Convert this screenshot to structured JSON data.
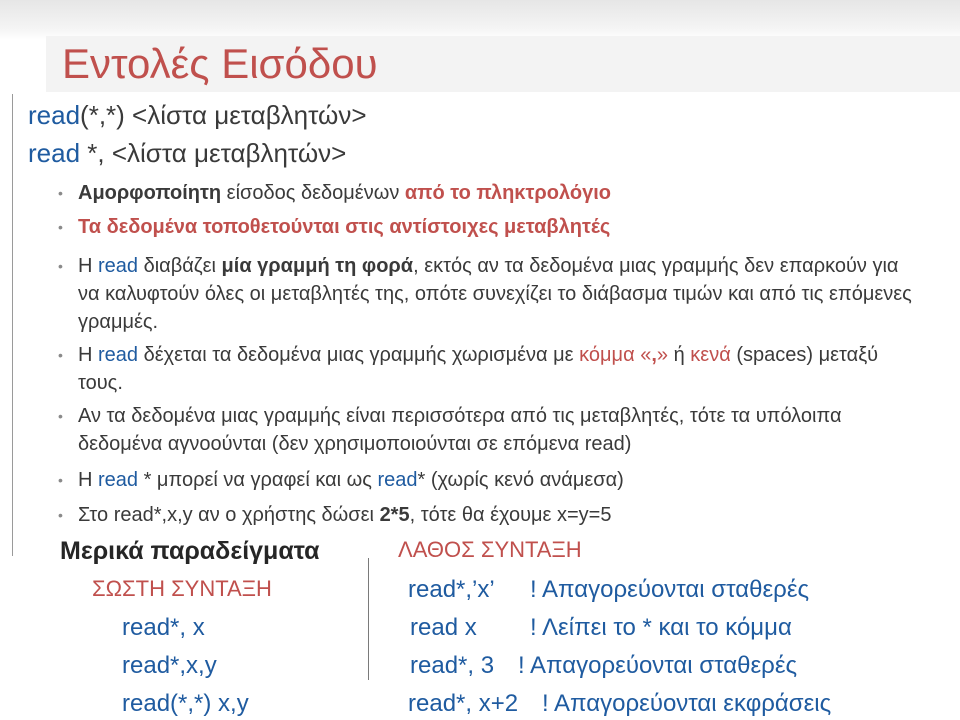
{
  "title": "Εντολές Εισόδου",
  "syntax": [
    {
      "kw": "read",
      "rest": "(*,*)  <λίστα μεταβλητών>"
    },
    {
      "kw": "read",
      "rest": " *, <λίστα μεταβλητών>"
    }
  ],
  "bullets": {
    "b1": {
      "bold": "Αμορφοποίητη",
      "mid": " είσοδος δεδομένων ",
      "red": "από το πληκτρολόγιο"
    },
    "b2": {
      "red": "Τα δεδομένα τοποθετούνται στις αντίστοιχες μεταβλητές"
    },
    "b3": {
      "a": "Η ",
      "read": "read",
      "b": " διαβάζει ",
      "bold": "μία γραμμή τη φορά",
      "c": ", εκτός αν τα δεδομένα μιας γραμμής δεν επαρκούν για να καλυφτούν όλες οι μεταβλητές της, οπότε συνεχίζει το διάβασμα τιμών και από τις επόμενες γραμμές."
    },
    "b4": {
      "a": "Η ",
      "read": "read",
      "b": " δέχεται τα δεδομένα μιας γραμμής χωρισμένα με ",
      "comma": "κόμμα",
      "c": " ",
      "q1": "«",
      "sym": ",",
      "q2": "»",
      "d": " ή ",
      "spaces": "κενά",
      "e": " (spaces) μεταξύ τους."
    },
    "b5": {
      "text": "Αν τα δεδομένα μιας γραμμής είναι περισσότερα από τις μεταβλητές, τότε τα υπόλοιπα δεδομένα αγνοούνται (δεν χρησιμοποιούνται σε επόμενα read)"
    },
    "b6": {
      "a": "Η ",
      "read1": "read",
      "b": " * μπορεί να γραφεί και ως ",
      "read2": "read",
      "c": "* (χωρίς κενό ανάμεσα)"
    },
    "b7": {
      "a": "Στο read*,x,y αν ο χρήστης δώσει ",
      "bold": "2*5",
      "c": ", τότε θα έχουμε x=y=5"
    }
  },
  "examples": {
    "heading": "Μερικά παραδείγματα",
    "correct_label": "ΣΩΣΤΗ ΣΥΝΤΑΞΗ",
    "wrong_label": "ΛΑΘΟΣ ΣΥΝΤΑΞΗ",
    "correct": [
      "read*, x",
      "read*,x,y",
      "read(*,*) x,y"
    ],
    "wrong": [
      {
        "code": "read*,’x’",
        "comment": "! Απαγορεύονται σταθερές"
      },
      {
        "code": "read x",
        "comment": "! Λείπει το * και το κόμμα"
      },
      {
        "code": "read*, 3",
        "comment": "! Απαγορεύονται σταθερές"
      },
      {
        "code": "read*, x+2",
        "comment": "! Απαγορεύονται εκφράσεις"
      }
    ]
  }
}
